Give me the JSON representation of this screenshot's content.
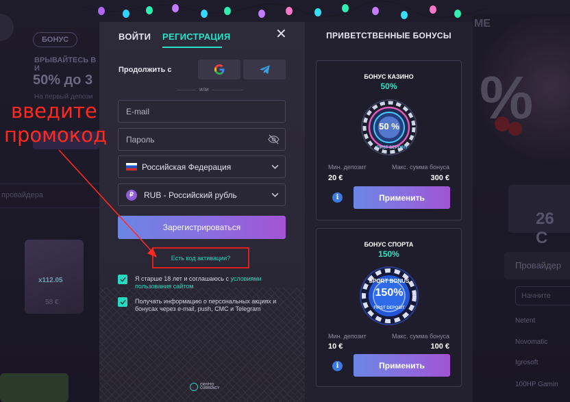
{
  "background": {
    "badge": "БОНУС",
    "promo_title": "ВРЫВАЙТЕСЬ В И",
    "promo_amount": "50% до 3",
    "promo_sub": "На первый депози",
    "search_placeholder": "провайдера",
    "game_multiplier": "x112.05",
    "game_price": "58 €",
    "right_word": "ME",
    "right_percent": "%",
    "timer_value": "26 С",
    "providers_title": "Провайдер",
    "providers_search": "Начните",
    "providers": [
      "Netent",
      "Novomatic",
      "Igrosoft",
      "100HP Gamin"
    ]
  },
  "auth": {
    "tab_login": "ВОЙТИ",
    "tab_register": "РЕГИСТРАЦИЯ",
    "close_symbol": "✕",
    "continue_with": "Продолжить с",
    "or": "или",
    "email_placeholder": "E-mail",
    "password_placeholder": "Пароль",
    "country": "Российская Федерация",
    "currency": "RUB - Российский рубль",
    "currency_symbol": "₽",
    "register_button": "Зарегистрироваться",
    "promo_link": "Есть код активации?",
    "checkbox1_text": "Я старше 18 лет и соглашаюсь с ",
    "checkbox1_link": "условиями пользования сайтом",
    "checkbox2_text": "Получать информацию о персональных акциях и бонусах через e-mail, push, СМС и Telegram",
    "logo_line1": "CRYPTO",
    "logo_line2": "CURRENCY"
  },
  "annotation": {
    "line1": "введите",
    "line2": "промокод",
    "color": "#ff2a1f"
  },
  "bonuses": {
    "title": "ПРИВЕТСТВЕННЫЕ БОНУСЫ",
    "cards": [
      {
        "name": "БОНУС КАЗИНО",
        "percent": "50%",
        "chip_text": "50 %",
        "chip_sub": "FIRST DEPOSIT",
        "min_label": "Мин. депозит",
        "min_value": "20 €",
        "max_label": "Макс. сумма бонуса",
        "max_value": "300 €",
        "apply": "Применить",
        "info": "i"
      },
      {
        "name": "БОНУС СПОРТА",
        "percent": "150%",
        "chip_text": "150%",
        "chip_top": "SPORT BONUS",
        "chip_sub": "FIRST DEPOSIT",
        "min_label": "Мин. депозит",
        "min_value": "10 €",
        "max_label": "Макс. сумма бонуса",
        "max_value": "100 €",
        "apply": "Применить",
        "info": "i"
      }
    ]
  },
  "colors": {
    "accent_teal": "#27e3c7",
    "button_gradient_start": "#6b86e4",
    "button_gradient_end": "#a253d4",
    "modal_bg": "#2d2a39"
  }
}
